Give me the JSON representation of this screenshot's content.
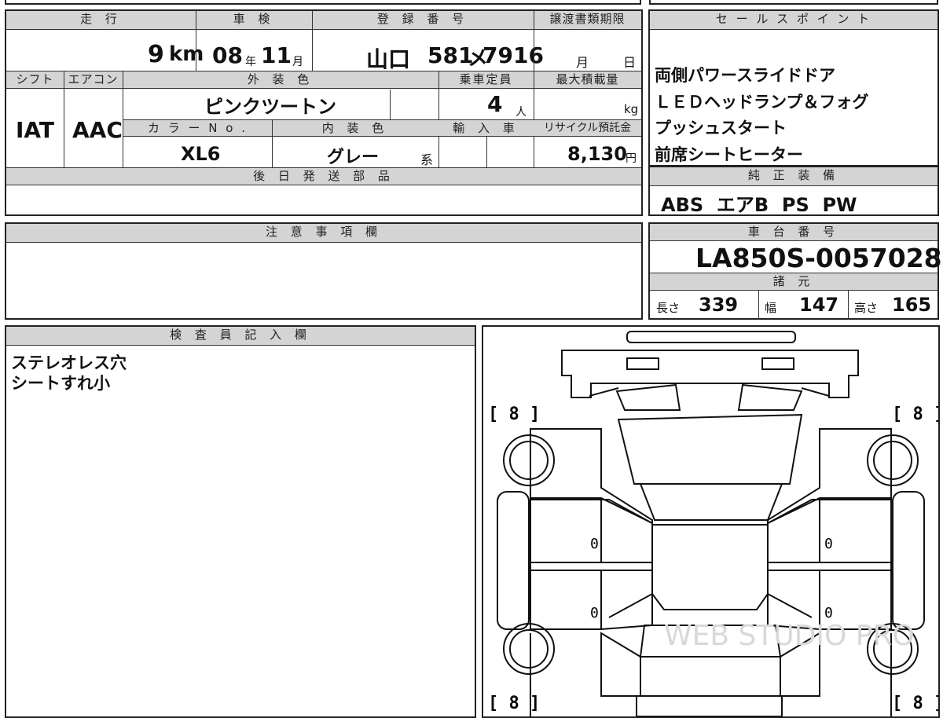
{
  "top_partial": {
    "text": "登録番号"
  },
  "vehicle_grid": {
    "mileage": {
      "header": "走 行",
      "value": "9",
      "unit": "km"
    },
    "shaken": {
      "header": "車 検",
      "year": "08",
      "year_unit": "年",
      "month": "11",
      "month_unit": "月"
    },
    "registration": {
      "header": "登 録 番 号",
      "region": "山口",
      "number": "581",
      "kana": "メ",
      "serial": "7916"
    },
    "transfer_deadline": {
      "header": "譲渡書類期限",
      "month_unit": "月",
      "day_unit": "日"
    },
    "shift": {
      "header": "シフト",
      "value": "IAT"
    },
    "aircon": {
      "header": "エアコン",
      "value": "AAC"
    },
    "exterior_color": {
      "header": "外 装 色",
      "value": "ピンクツートン"
    },
    "capacity": {
      "header": "乗車定員",
      "value": "4",
      "unit": "人"
    },
    "max_load": {
      "header": "最大積載量",
      "unit": "kg"
    },
    "color_no": {
      "header": "カ ラ ー N o .",
      "value": "XL6"
    },
    "interior_color": {
      "header": "内 装 色",
      "value": "グレー",
      "suffix": "系"
    },
    "import": {
      "header": "輸 入 車"
    },
    "recycle_fee": {
      "header": "リサイクル預託金",
      "value": "8,130",
      "unit": "円"
    },
    "later_parts": {
      "header": "後 日 発 送 部 品"
    }
  },
  "sales_points": {
    "header": "セ ー ル ス ポ イ ン ト",
    "lines": [
      "両側パワースライドドア",
      "ＬＥＤヘッドランプ＆フォグ",
      "プッシュスタート",
      "前席シートヒーター"
    ]
  },
  "genuine_equipment": {
    "header": "純 正 装 備",
    "value": "ABS  エアB  PS  PW"
  },
  "notes": {
    "header": "注 意 事 項 欄"
  },
  "chassis": {
    "header": "車 台 番 号",
    "value": "LA850S-0057028"
  },
  "specs": {
    "header": "諸 元",
    "length_label": "長さ",
    "length": "339",
    "width_label": "幅",
    "width": "147",
    "height_label": "高さ",
    "height": "165"
  },
  "inspector": {
    "header": "検 査 員 記 入 欄",
    "lines": [
      "ステレオレス穴",
      "シートすれ小"
    ]
  },
  "diagram": {
    "tread_fl": "[ 8 ]",
    "tread_fr": "[ 8 ]",
    "tread_rl": "[ 8 ]",
    "tread_rr": "[ 8 ]",
    "door_fl": "0",
    "door_fr": "0",
    "door_rl": "0",
    "door_rr": "0",
    "watermark": "WEB STUDIO PRO"
  }
}
